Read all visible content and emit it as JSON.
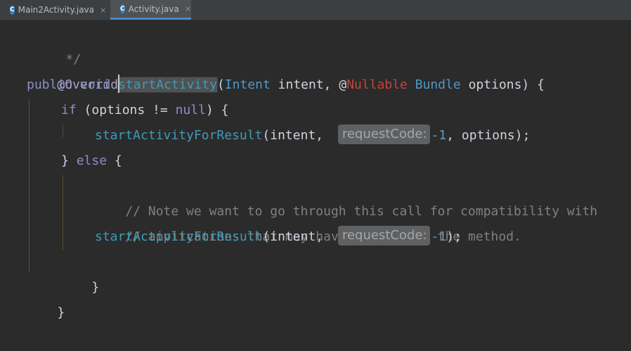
{
  "tabs": [
    {
      "icon": "class-c-icon",
      "icon_letter": "C",
      "label": "Main2Activity.java",
      "close": "×",
      "active": false
    },
    {
      "icon": "class-c-icon",
      "icon_letter": "C",
      "label": "Activity.java",
      "close": "×",
      "active": true
    }
  ],
  "code": {
    "l1": "*/",
    "l2": "@Override",
    "l3": {
      "kw": "public void ",
      "fn": "startActivity",
      "p1": "(",
      "ty1": "Intent",
      "p2": " intent, ",
      "at": "@",
      "ann": "Nullable",
      "sp": " ",
      "ty2": "Bundle",
      "p3": " options) {"
    },
    "l4": {
      "kw1": "if",
      "p1": " (options != ",
      "kw2": "null",
      "p2": ") {"
    },
    "l5": {
      "fn": "startActivityForResult",
      "p1": "(intent, ",
      "hint": "requestCode:",
      "num": "-1",
      "p2": ", options);"
    },
    "l6": {
      "p1": "} ",
      "kw": "else",
      "p2": " {"
    },
    "l7": "// Note we want to go through this call for compatibility with",
    "l8": "// applications that may have overridden the method.",
    "l9": {
      "fn": "startActivityForResult",
      "p1": "(intent, ",
      "hint": "requestCode:",
      "num": "-1",
      "p2": ");"
    },
    "l10": "}",
    "l11": "}"
  }
}
